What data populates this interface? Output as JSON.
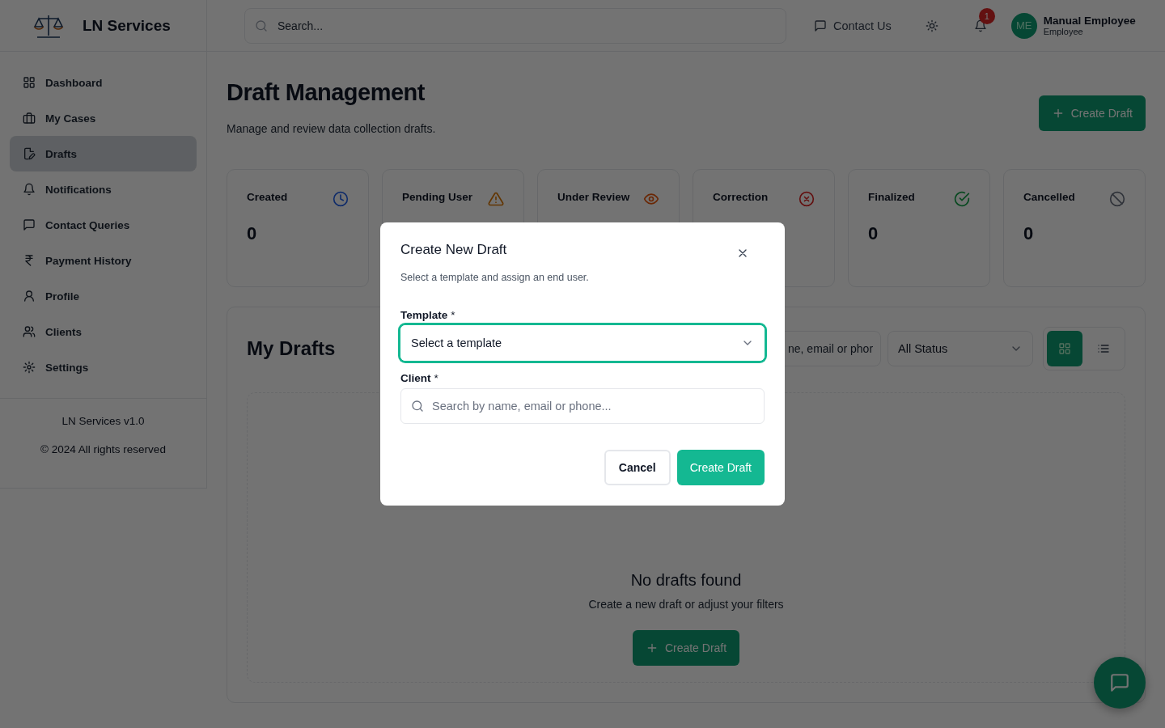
{
  "app": {
    "name": "LN Services",
    "version": "LN Services v1.0",
    "copyright": "© 2024 All rights reserved"
  },
  "sidebar": {
    "items": [
      {
        "label": "Dashboard",
        "kind": "grid",
        "selected": false
      },
      {
        "label": "My Cases",
        "kind": "briefcase",
        "selected": false
      },
      {
        "label": "Drafts",
        "kind": "edit",
        "selected": true
      },
      {
        "label": "Notifications",
        "kind": "bell",
        "selected": false
      },
      {
        "label": "Contact Queries",
        "kind": "chat",
        "selected": false
      },
      {
        "label": "Payment History",
        "kind": "rupee",
        "selected": false
      },
      {
        "label": "Profile",
        "kind": "user",
        "selected": false
      },
      {
        "label": "Clients",
        "kind": "users",
        "selected": false
      },
      {
        "label": "Settings",
        "kind": "gear",
        "selected": false
      }
    ]
  },
  "topbar": {
    "search": {
      "placeholder": "Search..."
    },
    "contact": "Contact Us",
    "notification_count": "1",
    "user": {
      "initials": "ME",
      "name": "Manual Employee",
      "role": "Employee"
    }
  },
  "page": {
    "title": "Draft Management",
    "subtitle": "Manage and review data collection drafts.",
    "create_button": "Create Draft"
  },
  "stats": [
    {
      "label": "Created",
      "value": "0",
      "kind": "clock"
    },
    {
      "label": "Pending User",
      "kind": "warning"
    },
    {
      "label": "Under Review",
      "kind": "eye"
    },
    {
      "label": "Correction",
      "kind": "x-circle"
    },
    {
      "label": "Finalized",
      "value": "0",
      "kind": "check-circle"
    },
    {
      "label": "Cancelled",
      "value": "0",
      "kind": "ban"
    }
  ],
  "drafts": {
    "title": "My Drafts",
    "search": {
      "placeholder": "ne, email or phor"
    },
    "status_filter": "All Status",
    "views": [
      {
        "kind": "grid",
        "selected": true
      },
      {
        "kind": "list",
        "selected": false
      }
    ],
    "empty": {
      "title": "No drafts found",
      "text": "Create a new draft or adjust your filters",
      "button": "Create Draft"
    }
  },
  "modal": {
    "title": "Create New Draft",
    "subtitle": "Select a template and assign an end user.",
    "fields": [
      {
        "label": "Template",
        "mark": "*",
        "kind": "select",
        "placeholder": "Select a template",
        "focused": true
      },
      {
        "label": "Client",
        "mark": "*",
        "kind": "search",
        "placeholder": "Search by name, email or phone...",
        "focused": false
      }
    ],
    "buttons": [
      {
        "label": "Cancel",
        "kind": "secondary"
      },
      {
        "label": "Create Draft",
        "kind": "primary"
      }
    ]
  }
}
